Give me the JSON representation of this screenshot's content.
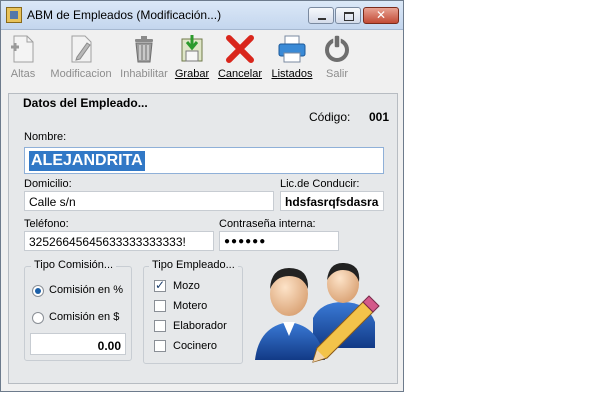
{
  "window": {
    "title": "ABM de Empleados (Modificación...)",
    "close_glyph": "✕"
  },
  "toolbar": [
    {
      "label": "Altas",
      "icon": "new-document-icon",
      "enabled": false
    },
    {
      "label": "Modificacion",
      "icon": "edit-document-icon",
      "enabled": false
    },
    {
      "label": "Inhabilitar",
      "icon": "trash-icon",
      "enabled": false
    },
    {
      "label": "Grabar",
      "icon": "save-icon",
      "enabled": true
    },
    {
      "label": "Cancelar",
      "icon": "cancel-icon",
      "enabled": true
    },
    {
      "label": "Listados",
      "icon": "printer-icon",
      "enabled": true
    },
    {
      "label": "Salir",
      "icon": "power-icon",
      "enabled": false
    }
  ],
  "form": {
    "section_title": "Datos del Empleado...",
    "codigo_label": "Código:",
    "codigo_value": "001",
    "nombre_label": "Nombre:",
    "nombre_value": "ALEJANDRITA",
    "domicilio_label": "Domicilio:",
    "domicilio_value": "Calle s/n",
    "licencia_label": "Lic.de Conducir:",
    "licencia_value": "hdsfasrqfsdasra",
    "telefono_label": "Teléfono:",
    "telefono_value": "32526645645633333333333!",
    "password_label": "Contraseña interna:",
    "password_value": "●●●●●●"
  },
  "comision": {
    "title": "Tipo Comisión...",
    "options": [
      {
        "label": "Comisión en %",
        "selected": true
      },
      {
        "label": "Comisión en $",
        "selected": false
      }
    ],
    "amount": "0.00"
  },
  "tipo_empleado": {
    "title": "Tipo Empleado...",
    "options": [
      {
        "label": "Mozo",
        "checked": true
      },
      {
        "label": "Motero",
        "checked": false
      },
      {
        "label": "Elaborador",
        "checked": false
      },
      {
        "label": "Cocinero",
        "checked": false
      }
    ]
  },
  "colors": {
    "selection": "#3178c6",
    "accent": "#1b5fa8"
  }
}
